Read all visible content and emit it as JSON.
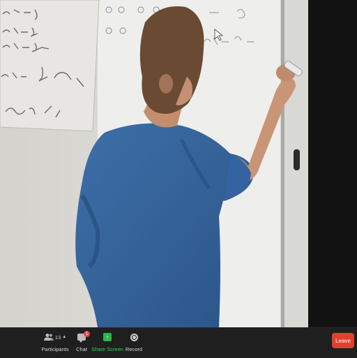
{
  "toolbar": {
    "participants": {
      "label": "Participants",
      "count": "13",
      "icon": "participants-icon"
    },
    "chat": {
      "label": "Chat",
      "badge": "1",
      "icon": "chat-icon"
    },
    "share_screen": {
      "label": "Share Screen",
      "icon": "share-screen-icon"
    },
    "record": {
      "label": "Record",
      "icon": "record-icon"
    },
    "leave": {
      "label": "Leave"
    }
  },
  "colors": {
    "toolbar_bg": "#1f1f1f",
    "share_green": "#2fd34f",
    "leave_red": "#e0402e",
    "badge_red": "#e5484d"
  }
}
